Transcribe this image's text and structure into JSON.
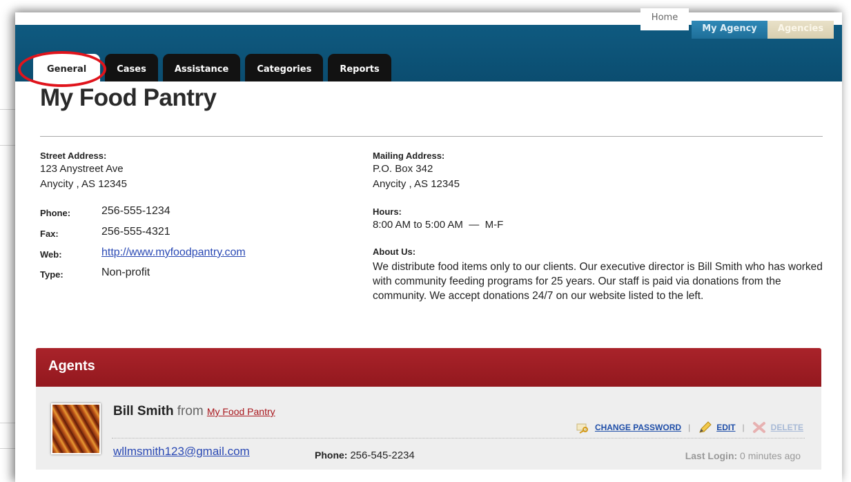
{
  "top_tabs": {
    "home": "Home",
    "my_agency": "My Agency",
    "agencies": "Agencies"
  },
  "nav_tabs": [
    "General",
    "Cases",
    "Assistance",
    "Categories",
    "Reports"
  ],
  "page_title": "My Food Pantry",
  "street_address": {
    "label": "Street Address:",
    "line1": "123 Anystreet Ave",
    "line2": "Anycity , AS 12345"
  },
  "contact": {
    "phone_label": "Phone:",
    "phone": "256-555-1234",
    "fax_label": "Fax:",
    "fax": "256-555-4321",
    "web_label": "Web:",
    "web": "http://www.myfoodpantry.com",
    "type_label": "Type:",
    "type": "Non-profit"
  },
  "mailing_address": {
    "label": "Mailing Address:",
    "line1": "P.O. Box 342",
    "line2": "Anycity , AS 12345"
  },
  "hours": {
    "label": "Hours:",
    "value": "8:00 AM to 5:00 AM  —  M-F"
  },
  "about": {
    "label": "About Us:",
    "text": "We distribute food items only to our clients. Our executive director is Bill Smith who has worked with community feeding programs for 25 years. Our staff is paid via donations from the community. We accept donations 24/7 on our website listed to the left."
  },
  "agents": {
    "title": "Agents",
    "items": [
      {
        "name": "Bill Smith",
        "from_word": "from",
        "agency": "My Food Pantry",
        "email": "wllmsmith123@gmail.com",
        "phone_label": "Phone:",
        "phone": "256-545-2234",
        "last_login_label": "Last Login:",
        "last_login": "0 minutes ago",
        "actions": {
          "change_password": "CHANGE PASSWORD",
          "edit": "EDIT",
          "delete": "DELETE",
          "separator": "|"
        }
      }
    ]
  },
  "colors": {
    "header_blue": "#0b4d70",
    "agents_red": "#a31f26",
    "link_blue": "#2a49b4",
    "highlight_ring": "#e0141c"
  },
  "icons": [
    "key-icon",
    "pencil-icon",
    "delete-x-icon"
  ]
}
